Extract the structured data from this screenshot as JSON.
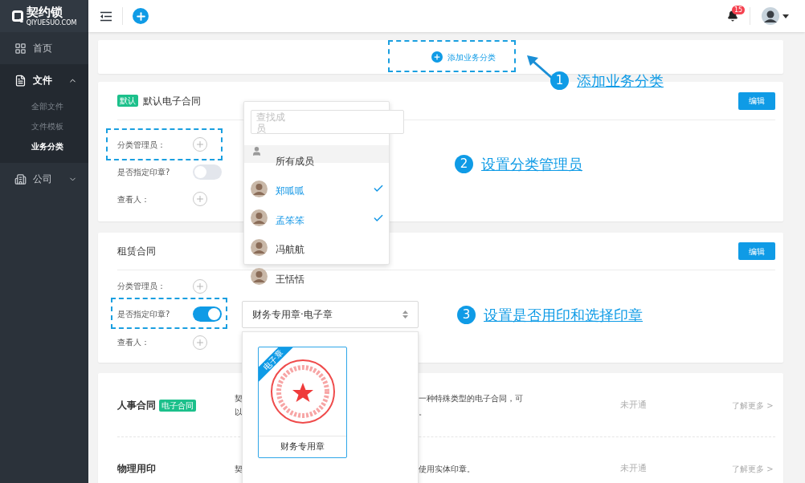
{
  "sidebar": {
    "logo": {
      "name": "契约锁",
      "subtitle": "QIYUESUO.COM"
    },
    "items": [
      {
        "label": "首页",
        "kind": "home",
        "selected": false,
        "expanded": false
      },
      {
        "label": "文件",
        "kind": "file",
        "selected": false,
        "expanded": true,
        "children": [
          {
            "label": "全部文件",
            "selected": false
          },
          {
            "label": "文件模板",
            "selected": false
          },
          {
            "label": "业务分类",
            "selected": true
          }
        ]
      },
      {
        "label": "公司",
        "kind": "company",
        "selected": false,
        "expanded": false
      }
    ]
  },
  "topbar": {
    "notification_count": "15"
  },
  "add_category": {
    "label": "添加业务分类"
  },
  "categories": [
    {
      "title": "默认电子合同",
      "tag": "默认",
      "edit": "编辑",
      "rows": [
        {
          "label": "分类管理员：",
          "kind": "add"
        },
        {
          "label": "是否指定印章?",
          "kind": "toggle",
          "on": false
        },
        {
          "label": "查看人：",
          "kind": "add"
        }
      ]
    },
    {
      "title": "租赁合同",
      "edit": "编辑",
      "rows": [
        {
          "label": "分类管理员：",
          "kind": "add"
        },
        {
          "label": "是否指定印章?",
          "kind": "toggle",
          "on": true
        },
        {
          "label": "查看人：",
          "kind": "add"
        }
      ]
    }
  ],
  "seal_select": {
    "value": "财务专用章·电子章",
    "options": [
      {
        "ribbon": "电子章",
        "name": "财务专用章",
        "selected": true
      }
    ]
  },
  "member_dropdown": {
    "placeholder": "查找成员",
    "all_members": "所有成员",
    "members": [
      {
        "name": "郑呱呱",
        "selected": true
      },
      {
        "name": "孟笨笨",
        "selected": true
      },
      {
        "name": "冯航航",
        "selected": false
      },
      {
        "name": "王恬恬",
        "selected": false
      }
    ]
  },
  "services": [
    {
      "title": "人事合同",
      "tag": "电子合同",
      "lines": [
        {
          "left": "契",
          "right": "一种特殊类型的电子合同，可"
        },
        {
          "left": "以",
          "right": "。"
        }
      ],
      "status": "未开通",
      "link": "了解更多 >"
    },
    {
      "title": "物理用印",
      "lines": [
        {
          "left": "契",
          "right": "使用实体印章。"
        }
      ],
      "status": "未开通",
      "link": "了解更多 >"
    }
  ],
  "annotations": [
    {
      "number": "1",
      "text": "添加业务分类"
    },
    {
      "number": "2",
      "text": "设置分类管理员"
    },
    {
      "number": "3",
      "text": "设置是否用印和选择印章"
    }
  ]
}
